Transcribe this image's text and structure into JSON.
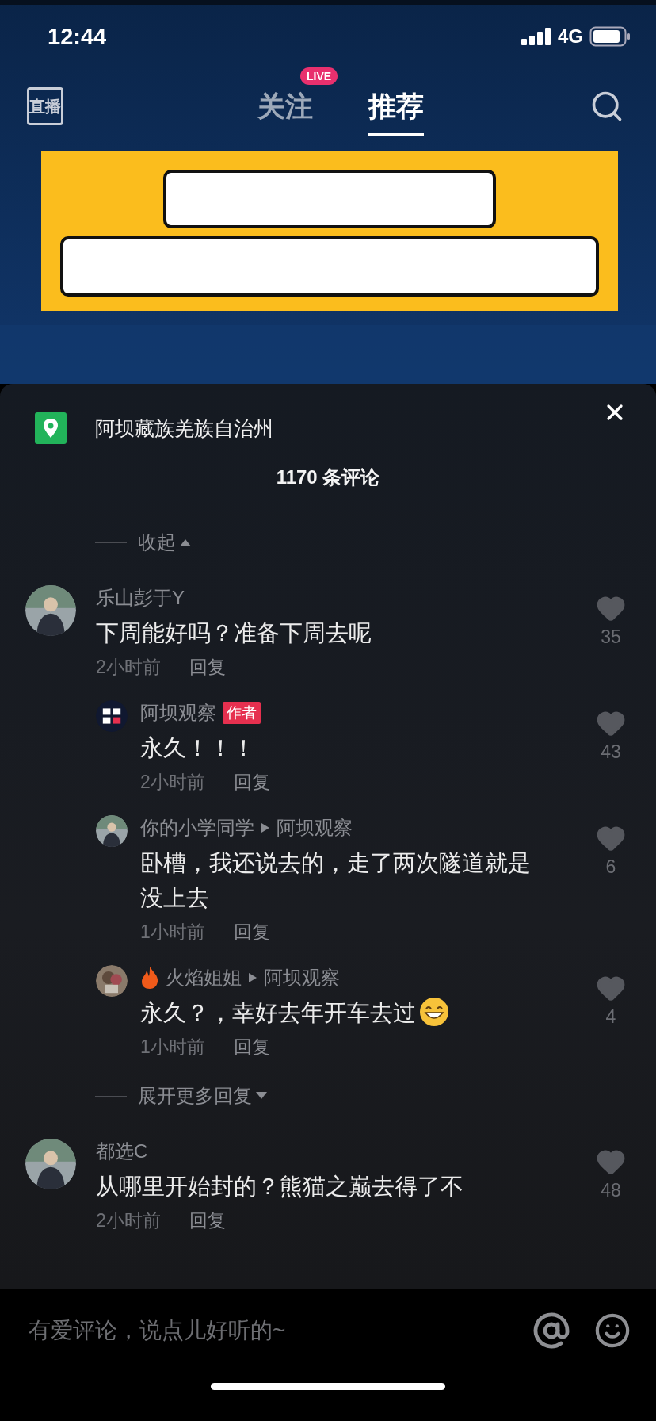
{
  "status_bar": {
    "time": "12:44",
    "network": "4G"
  },
  "top_nav": {
    "live_label": "直播",
    "tabs": [
      {
        "label": "关注",
        "selected": false,
        "badge": "LIVE"
      },
      {
        "label": "推荐",
        "selected": true
      }
    ]
  },
  "comments_panel": {
    "location": "阿坝藏族羌族自治州",
    "count_title": "1170 条评论",
    "collapse_label": "收起",
    "comments": [
      {
        "username": "乐山彭于Y",
        "text": "下周能好吗？准备下周去呢",
        "time": "2小时前",
        "reply_label": "回复",
        "likes": "35",
        "replies": [
          {
            "username": "阿坝观察",
            "author_tag": "作者",
            "text": "永久！！！",
            "time": "2小时前",
            "reply_label": "回复",
            "likes": "43",
            "flame": false,
            "grin": false
          },
          {
            "username": "你的小学同学",
            "reply_to": "阿坝观察",
            "text": "卧槽，我还说去的，走了两次隧道就是没上去",
            "time": "1小时前",
            "reply_label": "回复",
            "likes": "6",
            "flame": false,
            "grin": false
          },
          {
            "username": "火焰姐姐",
            "reply_to": "阿坝观察",
            "text": "永久？，幸好去年开车去过",
            "time": "1小时前",
            "reply_label": "回复",
            "likes": "4",
            "flame": true,
            "grin": true
          }
        ],
        "expand_label": "展开更多回复"
      },
      {
        "username": "都选C",
        "text": "从哪里开始封的？熊猫之巅去得了不",
        "time": "2小时前",
        "reply_label": "回复",
        "likes": "48"
      }
    ]
  },
  "comment_input": {
    "placeholder": "有爱评论，说点儿好听的~"
  }
}
